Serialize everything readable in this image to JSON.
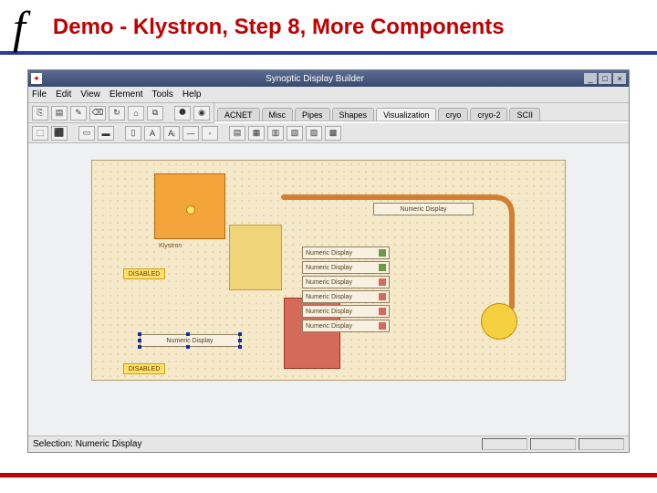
{
  "slide": {
    "logo": "f",
    "title": "Demo - Klystron, Step 8, More Components"
  },
  "app": {
    "title": "Synoptic Display Builder",
    "window_buttons": {
      "min": "_",
      "max": "□",
      "close": "×"
    },
    "menus": [
      "File",
      "Edit",
      "View",
      "Element",
      "Tools",
      "Help"
    ],
    "tabs": [
      "ACNET",
      "Misc",
      "Pipes",
      "Shapes",
      "Visualization",
      "cryo",
      "cryo-2",
      "SCII"
    ],
    "active_tab": "Visualization",
    "toolbar_icons": [
      "⎘",
      "▤",
      "✎",
      "⌫",
      "↻",
      "⌂",
      "⧉",
      "",
      "⯃",
      "◉",
      "",
      "⬚",
      "⬛",
      "",
      "▭",
      "▬",
      "",
      "▯",
      "A",
      "Aᵢ",
      "—",
      "◦",
      "",
      "▤",
      "▦",
      "▥",
      "▧",
      "▨",
      "▩"
    ],
    "status": "Selection: Numeric Display"
  },
  "canvas": {
    "klystron_label": "Klystron",
    "chip1": "DISABLED",
    "chip2": "DISABLED",
    "top_display": "Numeric Display",
    "left_display": "Numeric Display",
    "num_displays": [
      {
        "label": "Numeric Display",
        "color": "#6a9a4a"
      },
      {
        "label": "Numeric Display",
        "color": "#6a9a4a"
      },
      {
        "label": "Numeric Display",
        "color": "#d46a5a"
      },
      {
        "label": "Numeric Display",
        "color": "#d46a5a"
      },
      {
        "label": "Numeric Display",
        "color": "#d46a5a"
      },
      {
        "label": "Numeric Display",
        "color": "#d46a5a"
      }
    ]
  }
}
